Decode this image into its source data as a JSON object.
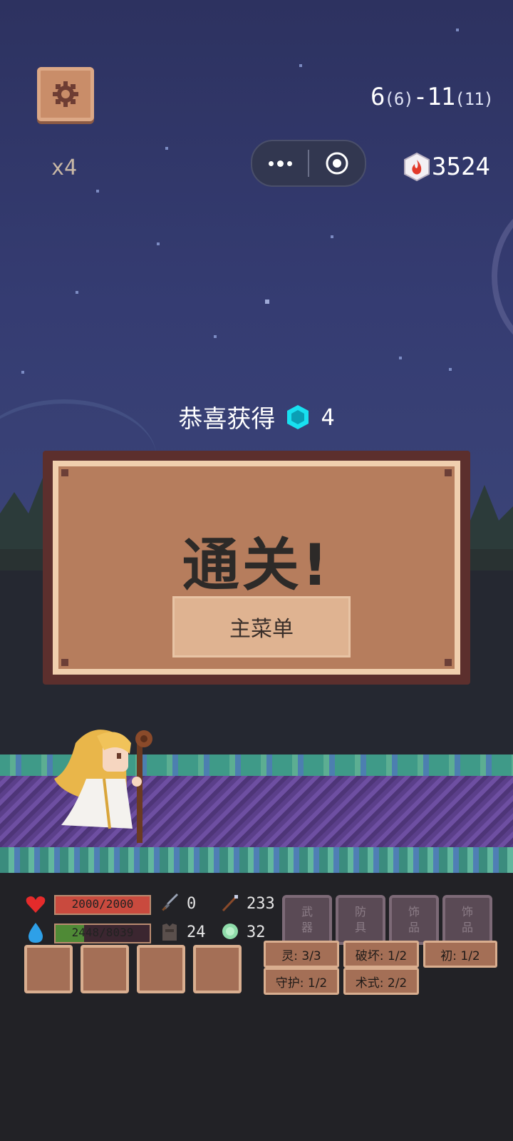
{
  "header": {
    "speed": "x4",
    "level_main": "6",
    "level_sub1": "(6)",
    "level_dash": "-11",
    "level_sub2": "(11)",
    "gems": "3524"
  },
  "reward": {
    "label": "恭喜获得",
    "amount": "4"
  },
  "panel": {
    "title": "通关!",
    "main_menu_button": "主菜单"
  },
  "stats": {
    "hp": "2000/2000",
    "hp_fraction": 1.0,
    "mp": "2448/8039",
    "mp_fraction": 0.3,
    "attack": "0",
    "magic": "233",
    "defense": "24",
    "resist": "32"
  },
  "equipment_slots": [
    {
      "line1": "武",
      "line2": "器"
    },
    {
      "line1": "防",
      "line2": "具"
    },
    {
      "line1": "饰",
      "line2": "品"
    },
    {
      "line1": "饰",
      "line2": "品"
    }
  ],
  "tags": [
    {
      "label": "灵: 3/3"
    },
    {
      "label": "破坏: 1/2"
    },
    {
      "label": "初: 1/2"
    },
    {
      "label": "守护: 1/2"
    },
    {
      "label": "术式: 2/2"
    }
  ],
  "colors": {
    "sky": "#353c72",
    "panel_face": "#b67d5d",
    "hp_bar": "#c94a3e",
    "mp_bar": "#4f8a36",
    "gem_cyan": "#18e0f0"
  }
}
